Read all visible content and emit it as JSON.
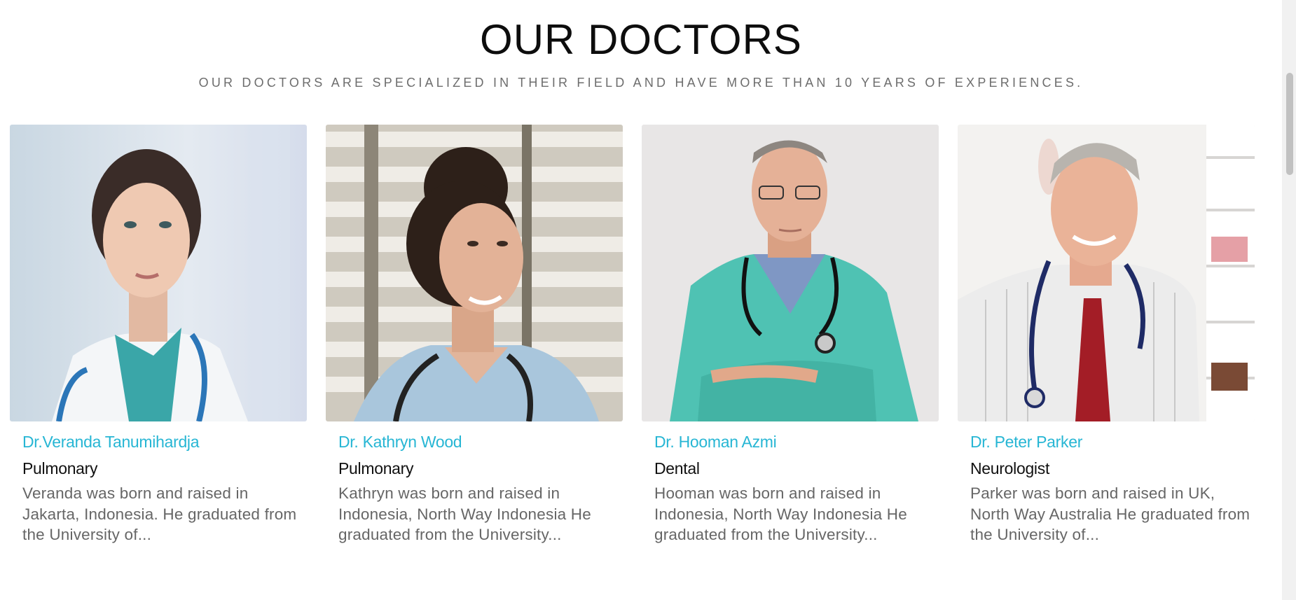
{
  "section": {
    "title": "OUR DOCTORS",
    "subtitle": "OUR DOCTORS ARE SPECIALIZED IN THEIR FIELD AND HAVE MORE THAN 10 YEARS OF EXPERIENCES."
  },
  "doctors": [
    {
      "name": "Dr.Veranda Tanumihardja",
      "specialty": "Pulmonary",
      "bio": "Veranda was born and raised in Jakarta, Indonesia. He graduated from the University of..."
    },
    {
      "name": "Dr. Kathryn Wood",
      "specialty": "Pulmonary",
      "bio": "Kathryn was born and raised in Indonesia, North Way Indonesia He graduated from the University..."
    },
    {
      "name": "Dr. Hooman Azmi",
      "specialty": "Dental",
      "bio": "Hooman was born and raised in Indonesia, North Way Indonesia He graduated from the University..."
    },
    {
      "name": "Dr. Peter Parker",
      "specialty": "Neurologist",
      "bio": "Parker was born and raised in UK, North Way Australia He graduated from the University of..."
    }
  ],
  "colors": {
    "name_accent": "#27b6d4",
    "subtitle_gray": "#6d6d6d",
    "bio_gray": "#666666"
  }
}
